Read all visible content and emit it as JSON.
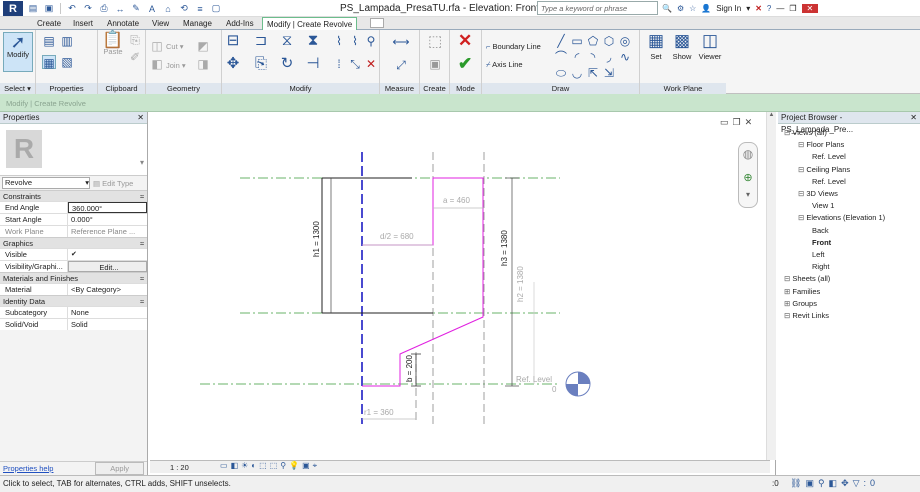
{
  "app_logo": "R",
  "document_title": "PS_Lampada_PresaTU.rfa - Elevation: Front",
  "search_placeholder": "Type a keyword or phrase",
  "sign_in": "Sign In",
  "tabs": [
    "Create",
    "Insert",
    "Annotate",
    "View",
    "Manage",
    "Add-Ins",
    "Modify | Create Revolve"
  ],
  "ribbon": {
    "modify_label": "Modify",
    "select_label": "Select",
    "properties_label": "Properties",
    "clipboard_label": "Clipboard",
    "paste_label": "Paste",
    "cut_label": "Cut",
    "join_label": "Join",
    "geometry_label": "Geometry",
    "modify_panel_label": "Modify",
    "measure_label": "Measure",
    "create_label": "Create",
    "mode_label": "Mode",
    "boundary_line": "Boundary Line",
    "axis_line": "Axis Line",
    "draw_label": "Draw",
    "set_label": "Set",
    "show_label": "Show",
    "viewer_label": "Viewer",
    "work_plane_label": "Work Plane"
  },
  "context_bar_text": "Modify | Create Revolve",
  "properties": {
    "title": "Properties",
    "type_name": "Revolve",
    "edit_type": "Edit Type",
    "groups": [
      {
        "name": "Constraints",
        "rows": [
          {
            "key": "End Angle",
            "value": "360.000°"
          },
          {
            "key": "Start Angle",
            "value": "0.000°"
          },
          {
            "key": "Work Plane",
            "value": "Reference Plane ..."
          }
        ]
      },
      {
        "name": "Graphics",
        "rows": [
          {
            "key": "Visible",
            "value": "✔"
          },
          {
            "key": "Visibility/Graphi...",
            "value": "Edit..."
          }
        ]
      },
      {
        "name": "Materials and Finishes",
        "rows": [
          {
            "key": "Material",
            "value": "<By Category>"
          }
        ]
      },
      {
        "name": "Identity Data",
        "rows": [
          {
            "key": "Subcategory",
            "value": "None"
          },
          {
            "key": "Solid/Void",
            "value": "Solid"
          }
        ]
      }
    ],
    "help_link": "Properties help",
    "apply": "Apply"
  },
  "drawing": {
    "dim_h1": "h1 = 1300",
    "dim_h3": "h3 = 1380",
    "dim_h2": "h2 = 1380",
    "dim_d2": "d/2 = 680",
    "dim_a": "a = 460",
    "dim_b": "b = 200",
    "dim_r1": "r1 = 360",
    "ref_level": "Ref. Level",
    "ref_level_value": "0"
  },
  "project_browser": {
    "title": "Project Browser - PS_Lampada_Pre...",
    "items": [
      {
        "label": "Views (all)",
        "indent": 0
      },
      {
        "label": "Floor Plans",
        "indent": 1
      },
      {
        "label": "Ref. Level",
        "indent": 2
      },
      {
        "label": "Ceiling Plans",
        "indent": 1
      },
      {
        "label": "Ref. Level",
        "indent": 2
      },
      {
        "label": "3D Views",
        "indent": 1
      },
      {
        "label": "View 1",
        "indent": 2
      },
      {
        "label": "Elevations (Elevation 1)",
        "indent": 1
      },
      {
        "label": "Back",
        "indent": 2
      },
      {
        "label": "Front",
        "indent": 2,
        "bold": true
      },
      {
        "label": "Left",
        "indent": 2
      },
      {
        "label": "Right",
        "indent": 2
      },
      {
        "label": "Sheets (all)",
        "indent": 0
      },
      {
        "label": "Families",
        "indent": 0
      },
      {
        "label": "Groups",
        "indent": 0
      },
      {
        "label": "Revit Links",
        "indent": 0
      }
    ]
  },
  "view_scale": "1 : 20",
  "status_text": "Click to select, TAB for alternates, CTRL adds, SHIFT unselects.",
  "status_zero": ":0",
  "colors": {
    "sketch": "#e020e0",
    "ref_plane_green": "#3a9a3a",
    "axis_blue": "#4a4ad0",
    "context_green": "#c9e5cd"
  }
}
